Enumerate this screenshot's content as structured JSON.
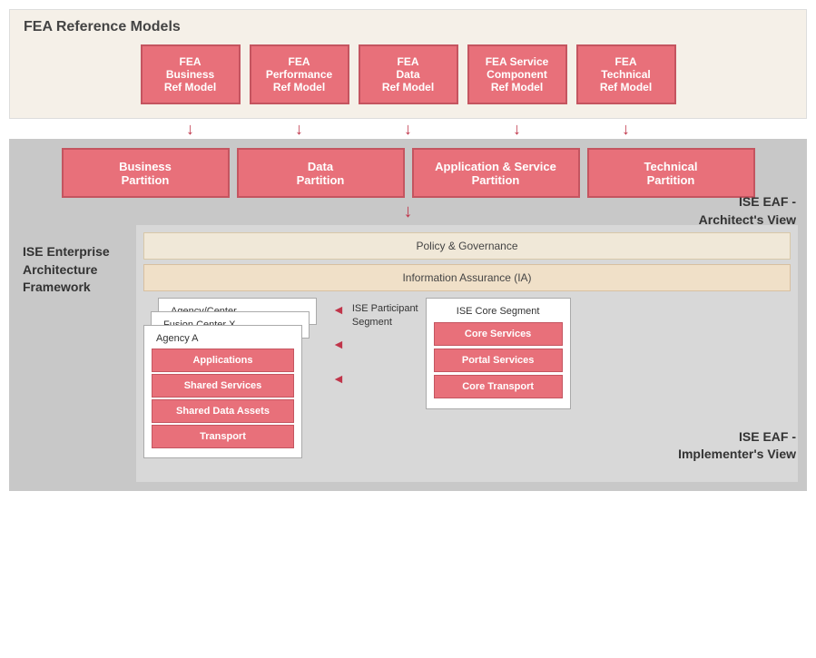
{
  "fea": {
    "title": "FEA Reference Models",
    "boxes": [
      {
        "label": "FEA Business Ref Model"
      },
      {
        "label": "FEA Performance Ref Model"
      },
      {
        "label": "FEA Data Ref Model"
      },
      {
        "label": "FEA Service Component Ref Model"
      },
      {
        "label": "FEA Technical Ref Model"
      }
    ]
  },
  "partitions": [
    {
      "label": "Business Partition"
    },
    {
      "label": "Data Partition"
    },
    {
      "label": "Application & Service Partition"
    },
    {
      "label": "Technical Partition"
    }
  ],
  "ise_eaf_architect": "ISE EAF -\nArchitect's View",
  "ise_eaf_implementer": "ISE EAF -\nImplementer's View",
  "ise_enterprise_label": "ISE Enterprise Architecture Framework",
  "policy_label": "Policy & Governance",
  "ia_label": "Information Assurance (IA)",
  "card_layers": [
    "Agency/Center ...",
    "Fusion Center X",
    "Agency A"
  ],
  "agency_sections": [
    {
      "label": "Applications"
    },
    {
      "label": "Shared Services"
    },
    {
      "label": "Shared Data Assets"
    },
    {
      "label": "Transport"
    }
  ],
  "participant_segment_label": "ISE Participant Segment",
  "core_segment": {
    "title": "ISE Core Segment",
    "rows": [
      "Core Services",
      "Portal Services",
      "Core Transport"
    ]
  }
}
